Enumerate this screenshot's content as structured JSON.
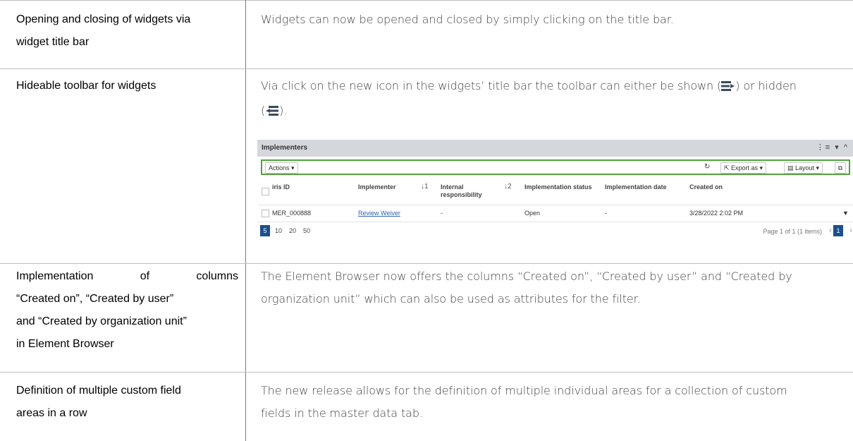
{
  "rows": [
    {
      "left": [
        "Opening and closing of widgets via",
        "widget title bar"
      ],
      "right": "Widgets can now be opened and closed by simply clicking on the title bar."
    },
    {
      "left": [
        "Hideable toolbar for widgets"
      ],
      "right_line1_a": "Via click on the new icon in the widgets’ title bar the toolbar can either be shown (",
      "right_line1_b": ") or hidden",
      "right_line2_a": "(",
      "right_line2_b": ")."
    },
    {
      "left_line1_a": "Implementation",
      "left_line1_b": "of",
      "left_line1_c": "columns",
      "left": [
        "“Created on”, “Created by user”",
        "and “Created by organization unit”",
        "in Element Browser"
      ],
      "right_line1": "The Element Browser now offers the columns “Created on”, “Created by user” and “Created by",
      "right_line2": "organization unit” which can also be used as attributes for the filter."
    },
    {
      "left": [
        "Definition of multiple custom field",
        "areas in a row"
      ],
      "right_line1": "The new release allows for the definition of multiple individual areas for a collection of custom",
      "right_line2": "fields in the master data tab."
    }
  ],
  "widget": {
    "title": "Implementers",
    "title_icons": "⋮≡ ▾ ^",
    "toolbar": {
      "actions": "Actions ▾",
      "refresh_icon": "↻",
      "export": "⇱ Export as ▾",
      "layout": "▤ Layout ▾",
      "copy_icon": "⧉"
    },
    "columns": [
      "iris ID",
      "Implementer",
      "Internal",
      "responsibility",
      "Implementation status",
      "Implementation date",
      "Created on"
    ],
    "sort_markers": [
      "↓1",
      "↓2"
    ],
    "row": {
      "id": "MER_000888",
      "implementer": "Review Weiver",
      "internal": "-",
      "status": "Open",
      "date": "-",
      "created": "3/28/2022 2:02 PM",
      "menu": "▼"
    },
    "pager": {
      "sizes": [
        "5",
        "10",
        "20",
        "50"
      ],
      "info": "Page 1 of 1 (1 items)",
      "prev": "‹",
      "current": "1",
      "next": "›"
    }
  },
  "icons": {
    "show_toolbar": "toolbar-show-icon",
    "hide_toolbar": "toolbar-hide-icon"
  },
  "colors": {
    "toolbar_border": "#4fa43b",
    "pager_active": "#1b4f8e",
    "link": "#2e63b6"
  }
}
